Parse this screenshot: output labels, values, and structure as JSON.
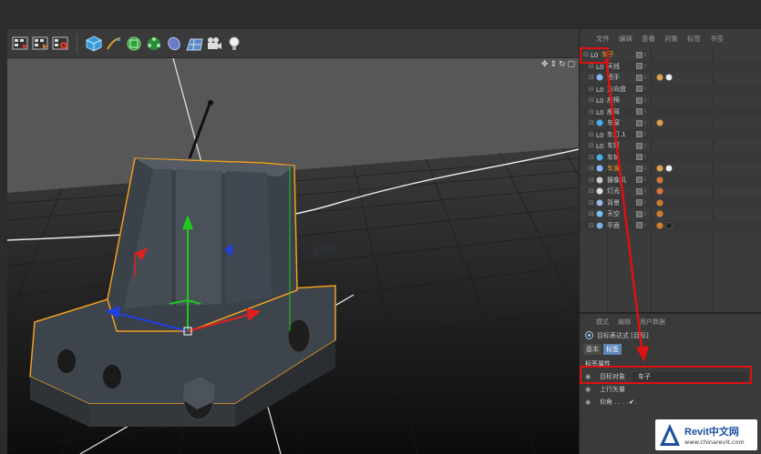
{
  "menu": {
    "items": [
      "文件",
      "编辑",
      "查看",
      "对象",
      "标签",
      "书签"
    ]
  },
  "objects": [
    {
      "name": "车子",
      "icon": "null-object-icon",
      "tags": [],
      "selected": true
    },
    {
      "name": "天线",
      "icon": "null-object-icon",
      "tags": []
    },
    {
      "name": "把手",
      "icon": "joint-icon",
      "tags": [
        "phong-tag-icon",
        "checker-tag-icon"
      ]
    },
    {
      "name": "方向盘",
      "icon": "null-object-icon",
      "tags": []
    },
    {
      "name": "座椅",
      "icon": "null-object-icon",
      "tags": []
    },
    {
      "name": "座驾",
      "icon": "null-object-icon",
      "tags": []
    },
    {
      "name": "车窗",
      "icon": "sphere-icon",
      "tags": [
        "phong-tag-icon"
      ]
    },
    {
      "name": "车灯.1",
      "icon": "null-object-icon",
      "tags": []
    },
    {
      "name": "车灯",
      "icon": "null-object-icon",
      "tags": []
    },
    {
      "name": "车轮",
      "icon": "sphere-icon",
      "tags": []
    },
    {
      "name": "车身",
      "icon": "joint-icon",
      "tags": [
        "phong-tag-icon",
        "checker-tag-icon"
      ],
      "highlight": true
    },
    {
      "name": "摄像机",
      "icon": "camera-icon",
      "tags": [
        "target-tag-icon"
      ]
    },
    {
      "name": "灯光",
      "icon": "light-icon",
      "tags": [
        "target-tag-icon"
      ]
    },
    {
      "name": "背景",
      "icon": "background-icon",
      "tags": [
        "texture-tag-icon"
      ]
    },
    {
      "name": "天空",
      "icon": "sky-icon",
      "tags": [
        "texture-tag-icon"
      ]
    },
    {
      "name": "平面",
      "icon": "plane-icon",
      "tags": [
        "texture-tag-icon",
        "material-tag-icon"
      ]
    }
  ],
  "attributes": {
    "menu": [
      "模式",
      "编辑",
      "用户数据"
    ],
    "title": "目标表达式 [目标]",
    "tabs": [
      "基本",
      "标签"
    ],
    "section": "标签属性",
    "target_label": "目标对象",
    "target_value": "车子",
    "up_vector_label": "上行矢量",
    "pitch_label": "仰角 . . . . . .",
    "pitch_checked": true
  },
  "watermark": {
    "brand": "Revit中文网",
    "url": "www.chinarevit.com"
  },
  "colors": {
    "highlight_red": "#e01010",
    "selection_orange": "#f0a020"
  }
}
